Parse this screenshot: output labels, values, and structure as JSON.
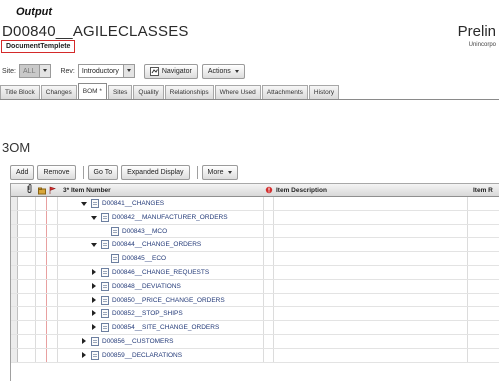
{
  "output_label": "Output",
  "header": {
    "title": "D00840__AGILECLASSES",
    "subtitle": "DocumentTemplete",
    "right_title": "Prelin",
    "right_sub": "Unincorpo"
  },
  "controls": {
    "site_label": "Site:",
    "site_value": "ALL",
    "rev_label": "Rev:",
    "rev_value": "Introductory",
    "navigator_label": "Navigator",
    "actions_label": "Actions"
  },
  "tabs": [
    {
      "label": "Title Block"
    },
    {
      "label": "Changes"
    },
    {
      "label": "BOM *"
    },
    {
      "label": "Sites"
    },
    {
      "label": "Quality"
    },
    {
      "label": "Relationships"
    },
    {
      "label": "Where Used"
    },
    {
      "label": "Attachments"
    },
    {
      "label": "History"
    }
  ],
  "section_title": "3OM",
  "toolbar": {
    "add": "Add",
    "remove": "Remove",
    "goto": "Go To",
    "expanded": "Expanded Display",
    "more": "More"
  },
  "columns": {
    "num": "3* Item Number",
    "desc": "Item Description",
    "rev": "Item R"
  },
  "rows": [
    {
      "label": "D00841__CHANGES",
      "state": "down",
      "level": 0
    },
    {
      "label": "D00842__MANUFACTURER_ORDERS",
      "state": "down",
      "level": 1
    },
    {
      "label": "D00843__MCO",
      "state": "none",
      "level": 2
    },
    {
      "label": "D00844__CHANGE_ORDERS",
      "state": "down",
      "level": 1
    },
    {
      "label": "D00845__ECO",
      "state": "none",
      "level": 2
    },
    {
      "label": "D00846__CHANGE_REQUESTS",
      "state": "right",
      "level": 1
    },
    {
      "label": "D00848__DEVIATIONS",
      "state": "right",
      "level": 1
    },
    {
      "label": "D00850__PRICE_CHANGE_ORDERS",
      "state": "right",
      "level": 1
    },
    {
      "label": "D00852__STOP_SHIPS",
      "state": "right",
      "level": 1
    },
    {
      "label": "D00854__SITE_CHANGE_ORDERS",
      "state": "right",
      "level": 1
    },
    {
      "label": "D00856__CUSTOMERS",
      "state": "right",
      "level": 0
    },
    {
      "label": "D00859__DECLARATIONS",
      "state": "right",
      "level": 0
    }
  ]
}
